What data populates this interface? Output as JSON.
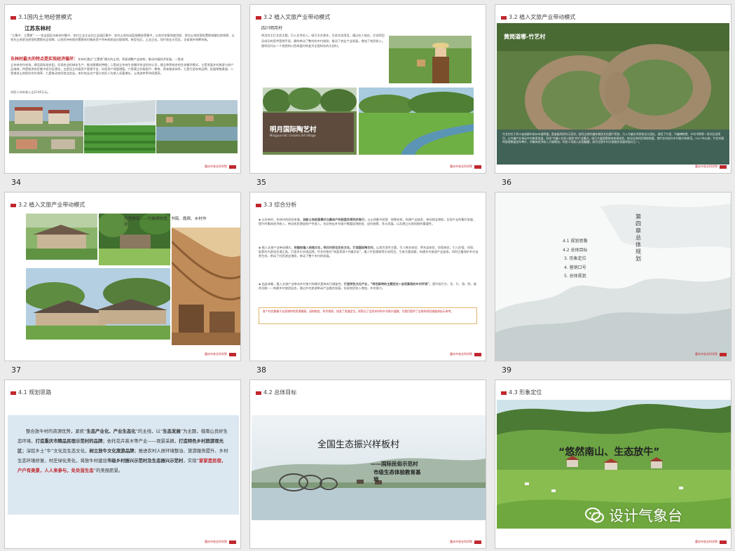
{
  "footer_text": "重庆市农业科学院",
  "slides": [
    {
      "id": "s34",
      "header": "3.1国内土地经营模式",
      "num": "34",
      "subtitle": "江苏东林村",
      "intro": "“三集中、三置换” ——农业园区向新农村集中、农村工业企业向工业园区集中、农村土地向适度规模经营集中，以农村宅基地使用权、承包土地经营权置换城镇住房保障、以农村土地承包经营权置换社会保障、以农民持有股份置换农村集体资产所有权收益分配保障。新型社区，工业企业，现代农业示范区，全省城乡统筹样板。",
      "feature": "东林村最大的特点是实现经济循环：",
      "feature_tail": "东林村通过“三置换”模式的土地，积极调整产业结构，推动村级经济发展，一是成",
      "body": "立东林合作农场，建设高标准农田，实现农业机械化生产，推进规模化种植；二是成立东林生态循环农业科技公司，建立种养结合的生态循环模式，三是发展乡村旅游与农产品电商；四是推进农民集中居住区建设，五是设立村级资产管理平台，实现资产保值增值，六是建立村级医疗、教育、养老服务体系，七是打造东林品牌，拓展销售渠道，八是推进土地股份合作改革，九是推动农民就业创业。本村农业总产值与农民人均收入显著增长，土地流转率持续提高，",
      "stat": "村民人均年收入达2146万元。"
    },
    {
      "id": "s35",
      "header": "3.2 植入文旅产业带动模式",
      "num": "35",
      "subtitle": "四川明月村",
      "text": "明月村主打文创主题，引入艺术名人，吸引文艺青年，引进文创项目，通过名人效应，文创项目及成功的宣传营销手段，最终带动了整村的乡村旅游，推动了农业产业发展，增加了农民收入。使明月村从一个贫困的川西林盘村转变为全国知名的文创村。",
      "sign_cn": "明月国际陶艺村",
      "sign_en": "Mingyue Intl. Ceramic Art Village"
    },
    {
      "id": "s36",
      "header": "3.2 植入文旅产业带动模式",
      "num": "36",
      "caption": "黄岗道哪-竹艺村",
      "text": "竹艺村位于四川省成都市崇州市道明镇，是省级四好村示范村，依托当地竹编非物质文化遗产资源，引入竹编艺术家和设计团队，建设了竹里、竹编博物馆、乡村书院等一系列文创项目，以竹编产业带动乡村旅游发展，形成“竹编+文创+旅游”的产业模式，吸引大量游客前来参观体验，带动当地村民增收致富，使竹艺村成为乡村振兴的典范。2017年以来，竹艺村接待游客数量逐年攀升，村集体经济收入大幅增加，村民人均收入实现翻番，成为全国乡村文旅融合发展样板村之一。"
    },
    {
      "id": "s37",
      "header": "3.2 植入文旅产业带动模式",
      "num": "37",
      "caption_line1": "竹里建筑——竹编博物馆、书院、霞宿、乡村作",
      "caption_line2": "坊"
    },
    {
      "id": "s38",
      "header": "3.3 综合分析",
      "num": "38",
      "bullets": [
        {
          "lead": "从东林村、东林村的经验来看，",
          "strong": "创新土地经营模式与集体产权制度改革同步推行，",
          "tail": "以土地集中经营、统筹安排，构建产业链条，带动就业增收，实现产业的集约发展，提升村集体经济收入，带动农民增加财产性收入。也反映出乡村振兴需要因地制宜、因村施策、多元发展，以及建立长效机制的重要性。"
        },
        {
          "lead": "植入文旅产业带动模式，",
          "strong": "挖掘和植入地域文化，明月村抓住历史文化，打造国际陶艺村，",
          "tail": "以其为宣传主题，引入陶艺体验、草木染体验、民宿体验，引入民宿、住宿、配套村内游览交通工具，打造乡村文旅品牌。竹艺村依托“林盘资源+竹编文化”，植入竹里建筑等文创项目，引来大量游客，构建乡村旅游产业链条。同时注重保护乡村自然生态，带动了村民就业增收，带动了整个乡村的发展。"
        },
        {
          "lead": "由此来看，植入文旅产业带动乡村振兴的模式是具有可借鉴性，",
          "strong": "打造特色文化产业，“特色鲜明的主题定位+自然景观的乡村环境”，",
          "tail": "提升吸引力、住、行、游、购、娱的功能——构建乡村旅游业态，通过乡村旅游带动产业融合发展，实现农民收入增加，乡村振兴。"
        }
      ],
      "note": "各个村庄都基于自身独特的资源禀赋，因地制宜、科学规划，找准了发展定位，探索出了适合本村的乡村振兴道路，为我们提供了宝贵的经验借鉴和启示参考。"
    },
    {
      "id": "s39",
      "num": "39",
      "chapter": "第四章 总体规划",
      "toc": [
        "4.1 规划思路",
        "4.2 总体目标",
        "3. 形象定位",
        "4. 营销口号",
        "5. 总体规划"
      ]
    },
    {
      "id": "s40",
      "header": "4.1 规划思路",
      "paragraph": [
        {
          "t": "整合放牛村的资源优势，紧抓“",
          "s": "n"
        },
        {
          "t": "生态产业化、产业生态化",
          "s": "b"
        },
        {
          "t": "”的主线，以“",
          "s": "n"
        },
        {
          "t": "生态发展",
          "s": "b"
        },
        {
          "t": "”为主题，借南山良好生态环境，",
          "s": "n"
        },
        {
          "t": "打造重庆市精品民宿示范村的品牌",
          "s": "b"
        },
        {
          "t": "；依托花卉苗木等产业——观景采摘，",
          "s": "n"
        },
        {
          "t": "打造特色乡村旅游观光区",
          "s": "b"
        },
        {
          "t": "；深挖乡土“牛”文化及生态文化，",
          "s": "n"
        },
        {
          "t": "树立放牛文化旅游品牌",
          "s": "b"
        },
        {
          "t": "；推进农村人居环境整治、旅游服务提升、乡村生态环境修复、村庄绿化美化，将放牛村建设",
          "s": "n"
        },
        {
          "t": "市级乡村振兴示范村及生态振兴示范村",
          "s": "b"
        },
        {
          "t": "，实现“",
          "s": "n"
        },
        {
          "t": "家家是民宿，户户有美景，人人来参与，处处皆生态",
          "s": "r"
        },
        {
          "t": "”的美丽愿景。",
          "s": "n"
        }
      ]
    },
    {
      "id": "s41",
      "header": "4.2 总体目标",
      "title": "全国生态振兴样板村",
      "sub1": "——国际民俗示范村",
      "sub2": "市级生态体验教育基地"
    },
    {
      "id": "s42",
      "header": "4.3 形象定位",
      "slogan": "“悠然南山、生态放牛”",
      "watermark": "设计气象台"
    }
  ]
}
